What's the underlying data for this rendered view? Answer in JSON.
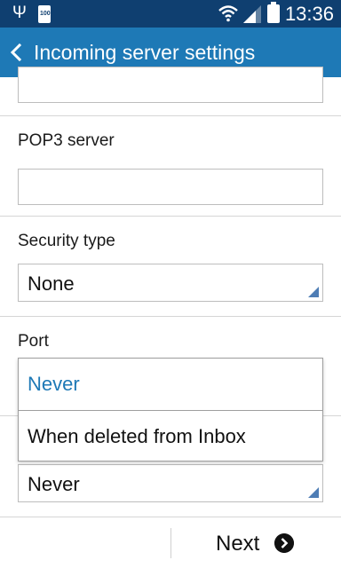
{
  "status_bar": {
    "time": "13:36",
    "battery_level_label": "100",
    "icons": [
      "usb-icon",
      "battery-full-small-icon",
      "wifi-icon",
      "signal-icon",
      "battery-icon"
    ]
  },
  "action_bar": {
    "title": "Incoming server settings",
    "back_icon": "chevron-left-icon"
  },
  "form": {
    "top_field_value": "",
    "pop3_server": {
      "label": "POP3 server",
      "value": ""
    },
    "security_type": {
      "label": "Security type",
      "selected": "None"
    },
    "port": {
      "label": "Port"
    },
    "delete_option": {
      "selected": "Never"
    }
  },
  "dropdown": {
    "options": [
      {
        "label": "Never",
        "highlighted": true
      },
      {
        "label": "When deleted from Inbox",
        "highlighted": false
      }
    ]
  },
  "bottom_bar": {
    "next_label": "Next",
    "next_icon": "chevron-right-circle-icon"
  },
  "colors": {
    "status_bar": "#0f3f70",
    "action_bar": "#1e79b6",
    "highlight_text": "#1e79b6",
    "select_corner": "#4e7db5"
  }
}
